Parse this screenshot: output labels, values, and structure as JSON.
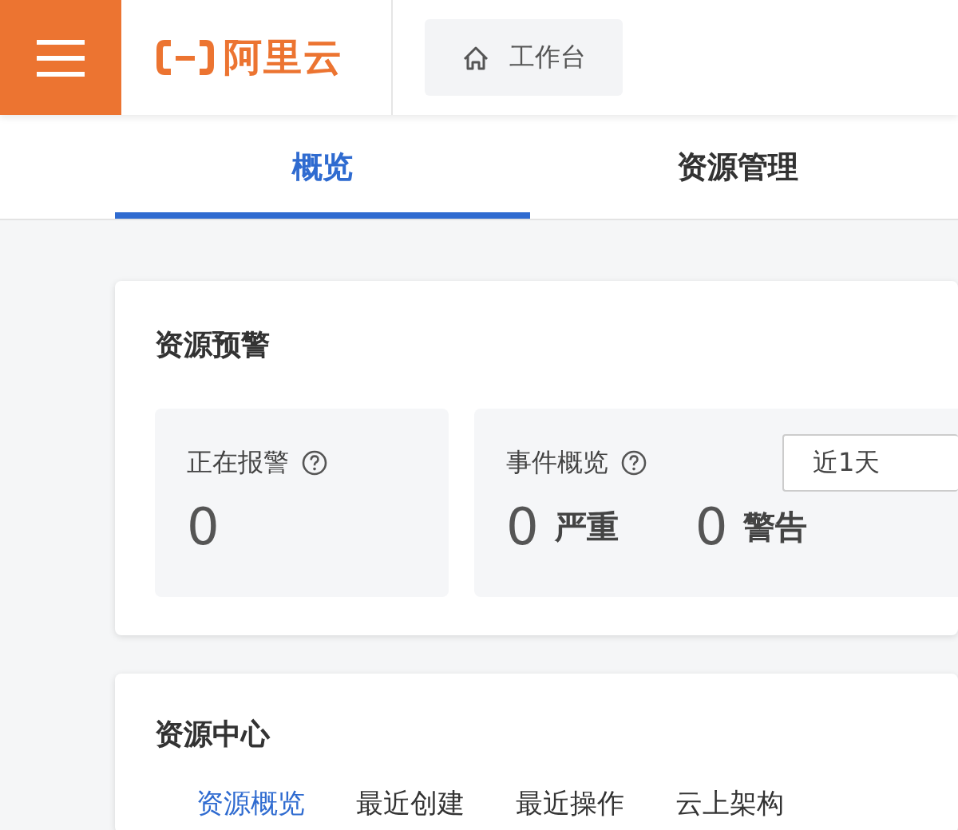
{
  "header": {
    "logo_text": "阿里云",
    "breadcrumb": "工作台"
  },
  "tabs": [
    {
      "label": "概览",
      "selected": true
    },
    {
      "label": "资源管理",
      "selected": false
    }
  ],
  "alert_card": {
    "title": "资源预警",
    "tiles": [
      {
        "kind": "single",
        "label": "正在报警",
        "value": "0"
      },
      {
        "kind": "events",
        "label": "事件概览",
        "range": "近1天",
        "counts": [
          {
            "value": "0",
            "label": "严重"
          },
          {
            "value": "0",
            "label": "警告"
          }
        ]
      }
    ]
  },
  "resource_card": {
    "title": "资源中心",
    "tabs": [
      {
        "label": "资源概览",
        "selected": true
      },
      {
        "label": "最近创建",
        "selected": false
      },
      {
        "label": "最近操作",
        "selected": false
      },
      {
        "label": "云上架构",
        "selected": false
      }
    ]
  }
}
